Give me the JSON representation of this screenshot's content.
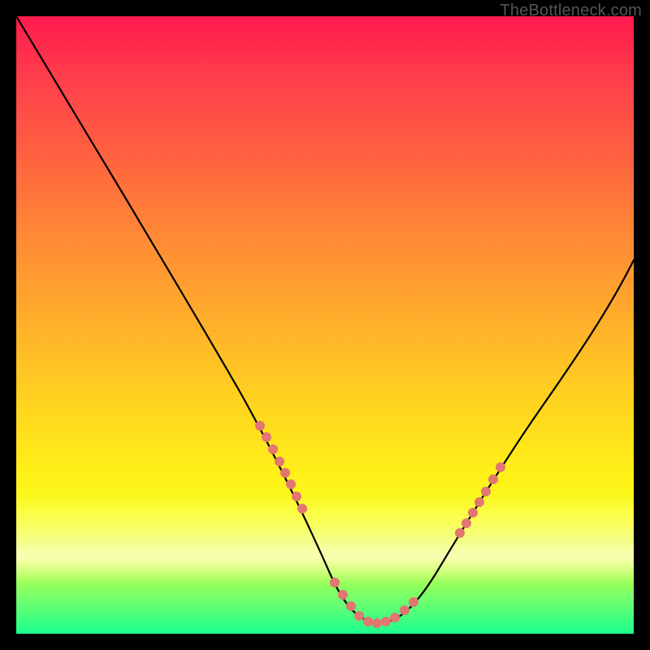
{
  "watermark": "TheBottleneck.com",
  "chart_data": {
    "type": "line",
    "title": "",
    "xlabel": "",
    "ylabel": "",
    "xlim": [
      0,
      100
    ],
    "ylim": [
      0,
      100
    ],
    "grid": false,
    "legend": false,
    "series": [
      {
        "name": "bottleneck-curve",
        "x": [
          0,
          6,
          12,
          18,
          24,
          30,
          36,
          42,
          47,
          51,
          55,
          58,
          62,
          66,
          70,
          75,
          80,
          86,
          92,
          100
        ],
        "y": [
          100,
          90,
          80,
          69,
          58,
          47,
          37,
          27,
          17,
          9,
          4,
          2,
          3,
          7,
          13,
          21,
          30,
          40,
          50,
          62
        ]
      }
    ],
    "markers": {
      "left_cluster": {
        "x_range": [
          38,
          46
        ],
        "count": 8
      },
      "valley_cluster": {
        "x_range": [
          50,
          63
        ],
        "count": 10
      },
      "right_cluster": {
        "x_range": [
          68,
          75
        ],
        "count": 7
      }
    },
    "background_gradient": {
      "top_color": "#ff1a4d",
      "mid_color": "#ffd21f",
      "bottom_color": "#1cff8f"
    }
  }
}
